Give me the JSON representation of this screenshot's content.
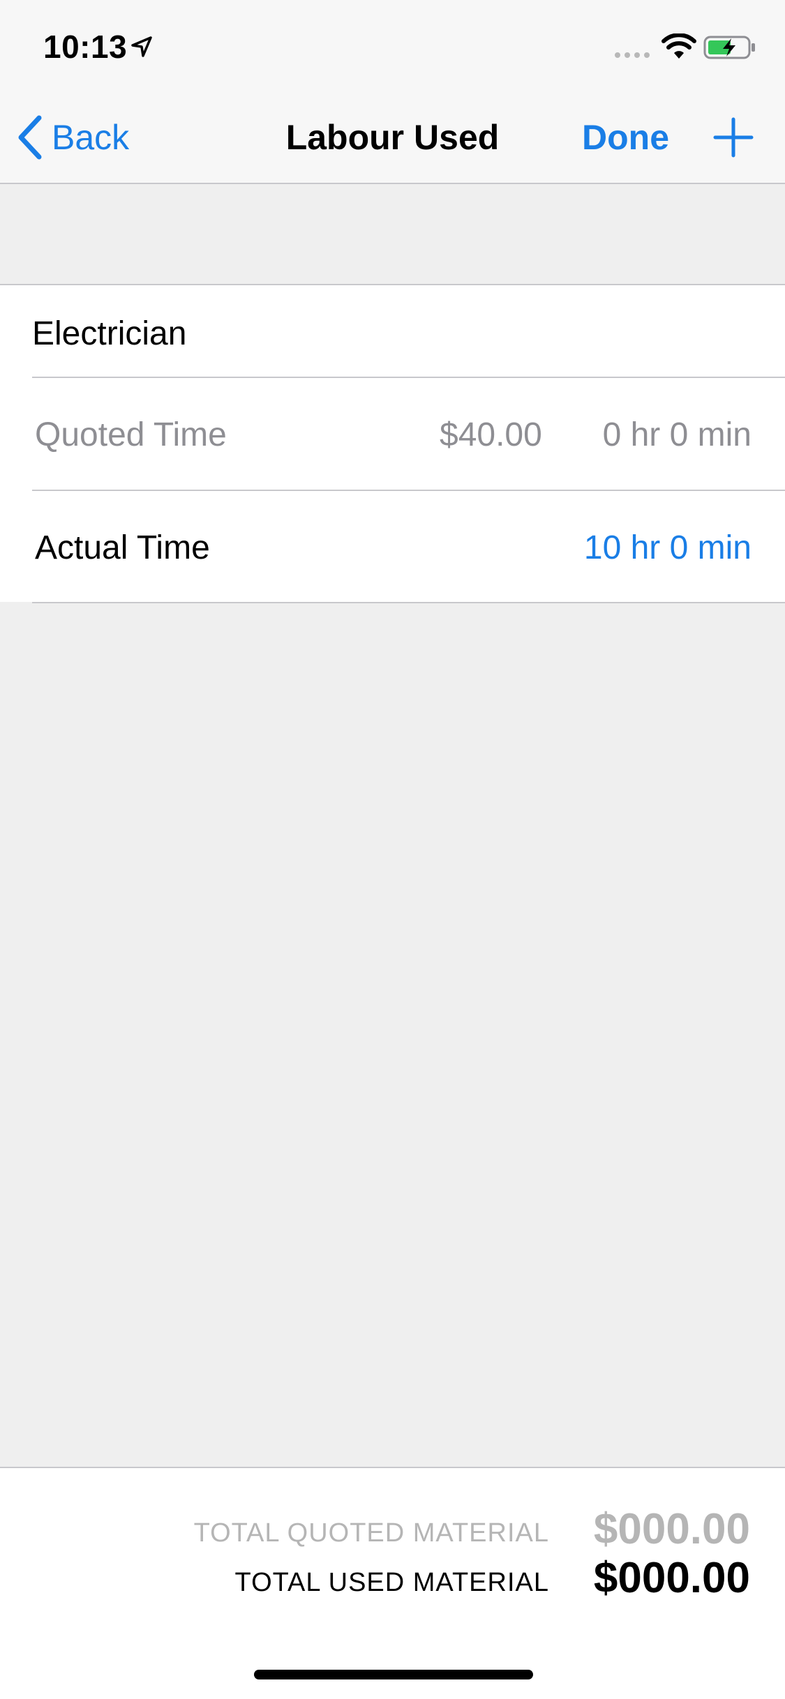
{
  "status_bar": {
    "time": "10:13"
  },
  "nav": {
    "back_label": "Back",
    "title": "Labour Used",
    "done_label": "Done"
  },
  "labour": {
    "name": "Electrician",
    "quoted": {
      "label": "Quoted Time",
      "price": "$40.00",
      "duration": "0 hr 0 min"
    },
    "actual": {
      "label": "Actual Time",
      "duration": "10 hr 0 min"
    }
  },
  "footer": {
    "total_quoted_label": "TOTAL QUOTED MATERIAL",
    "total_quoted_amount": "$000.00",
    "total_used_label": "TOTAL USED MATERIAL",
    "total_used_amount": "$000.00"
  },
  "colors": {
    "accent": "#1a7ee6",
    "secondary_text": "#8e8e93",
    "muted_total": "#b5b5b5",
    "background": "#efefef",
    "separator": "#c8c8cc",
    "battery_green": "#34c759"
  },
  "icons": {
    "location": "location-arrow-icon",
    "signal": "cellular-signal-icon",
    "wifi": "wifi-icon",
    "battery": "battery-charging-icon",
    "back": "chevron-left-icon",
    "add": "plus-icon"
  }
}
